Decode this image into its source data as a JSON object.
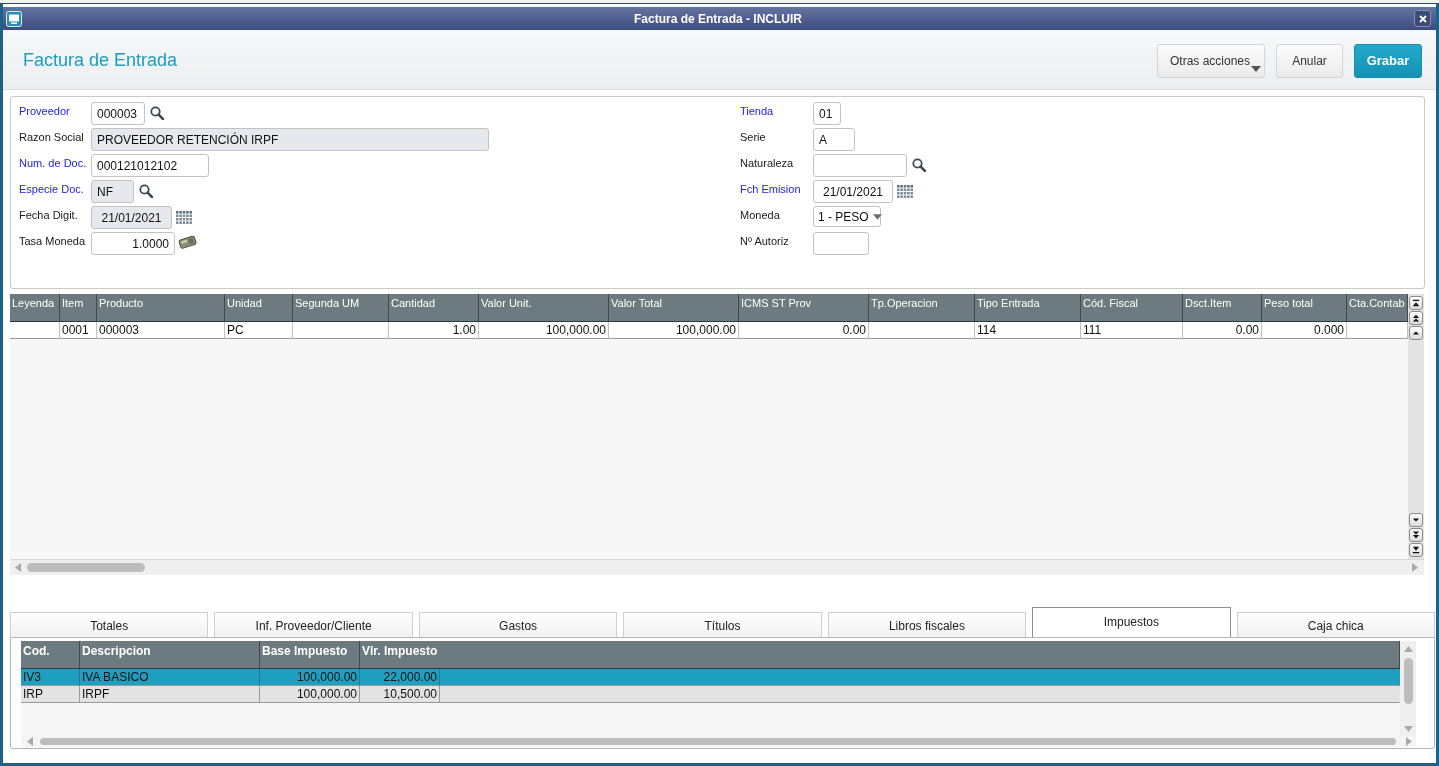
{
  "window": {
    "title": "Factura de Entrada - INCLUIR"
  },
  "header": {
    "title": "Factura de Entrada",
    "actions": [
      {
        "label": "Otras acciones",
        "kind": "menu"
      },
      {
        "label": "Anular",
        "kind": "secondary"
      },
      {
        "label": "Grabar",
        "kind": "primary"
      }
    ]
  },
  "form": {
    "left_fields": [
      {
        "label": "Proveedor",
        "value": "000003",
        "kind": "lookup",
        "required": true,
        "readonly": false
      },
      {
        "label": "Razon Social",
        "value": "PROVEEDOR RETENCIÓN IRPF",
        "kind": "text",
        "required": false,
        "readonly": true
      },
      {
        "label": "Num. de Doc.",
        "value": "000121012102",
        "kind": "text",
        "required": true,
        "readonly": false
      },
      {
        "label": "Especie Doc.",
        "value": "NF",
        "kind": "lookup",
        "required": true,
        "readonly": true
      },
      {
        "label": "Fecha Digit.",
        "value": "21/01/2021",
        "kind": "date",
        "required": false,
        "readonly": true
      },
      {
        "label": "Tasa Moneda",
        "value": "1.0000",
        "kind": "calculator",
        "required": false,
        "readonly": false
      }
    ],
    "right_fields": [
      {
        "label": "Tienda",
        "value": "01",
        "kind": "text",
        "required": true,
        "readonly": false
      },
      {
        "label": "Serie",
        "value": "A",
        "kind": "text",
        "required": false,
        "readonly": false
      },
      {
        "label": "Naturaleza",
        "kind": "lookup",
        "required": false,
        "readonly": false
      },
      {
        "label": "Fch Emision",
        "value": "21/01/2021",
        "kind": "date",
        "required": true,
        "readonly": false
      },
      {
        "label": "Moneda",
        "value": "1 - PESO",
        "kind": "select",
        "required": false,
        "readonly": false
      },
      {
        "label": "Nº Autoriz",
        "kind": "text",
        "required": false,
        "readonly": false
      }
    ]
  },
  "items_grid": {
    "columns": [
      {
        "label": "Leyenda",
        "kind": "text"
      },
      {
        "label": "Item",
        "kind": "text"
      },
      {
        "label": "Producto",
        "kind": "text"
      },
      {
        "label": "Unidad",
        "kind": "text"
      },
      {
        "label": "Segunda UM",
        "kind": "text"
      },
      {
        "label": "Cantidad",
        "kind": "number"
      },
      {
        "label": "Valor Unit.",
        "kind": "number"
      },
      {
        "label": "Valor Total",
        "kind": "number"
      },
      {
        "label": "ICMS ST Prov",
        "kind": "number"
      },
      {
        "label": "Tp.Operacion",
        "kind": "text"
      },
      {
        "label": "Tipo Entrada",
        "kind": "text"
      },
      {
        "label": "Cód. Fiscal",
        "kind": "text"
      },
      {
        "label": "Dsct.Item",
        "kind": "number"
      },
      {
        "label": "Peso total",
        "kind": "number"
      },
      {
        "label": "Cta.Contab",
        "kind": "text"
      }
    ],
    "rows": [
      {
        "item": "0001",
        "producto": "000003",
        "unidad": "PC",
        "cantidad": "1.00",
        "valor_unit": "100,000.00",
        "valor_total": "100,000.00",
        "icms_st_prov": "0.00",
        "tipo_entrada": "114",
        "cod_fiscal": "111",
        "dsct_item": "0.00",
        "peso_total": "0.000"
      }
    ]
  },
  "tabs": [
    {
      "label": "Totales",
      "selected": false
    },
    {
      "label": "Inf. Proveedor/Cliente",
      "selected": false
    },
    {
      "label": "Gastos",
      "selected": false
    },
    {
      "label": "Títulos",
      "selected": false
    },
    {
      "label": "Libros fiscales",
      "selected": false
    },
    {
      "label": "Impuestos",
      "selected": true
    },
    {
      "label": "Caja chica",
      "selected": false
    }
  ],
  "tax_grid": {
    "columns": [
      {
        "label": "Cod.",
        "kind": "text"
      },
      {
        "label": "Descripcion",
        "kind": "text"
      },
      {
        "label": "Base Impuesto",
        "kind": "number"
      },
      {
        "label": "Vlr. Impuesto",
        "kind": "number"
      }
    ],
    "rows": [
      {
        "cells": [
          "IV3",
          "IVA BASICO",
          "100,000.00",
          "22,000.00"
        ],
        "selected": true
      },
      {
        "cells": [
          "IRP",
          "IRPF",
          "100,000.00",
          "10,500.00"
        ],
        "selected": false
      }
    ]
  }
}
